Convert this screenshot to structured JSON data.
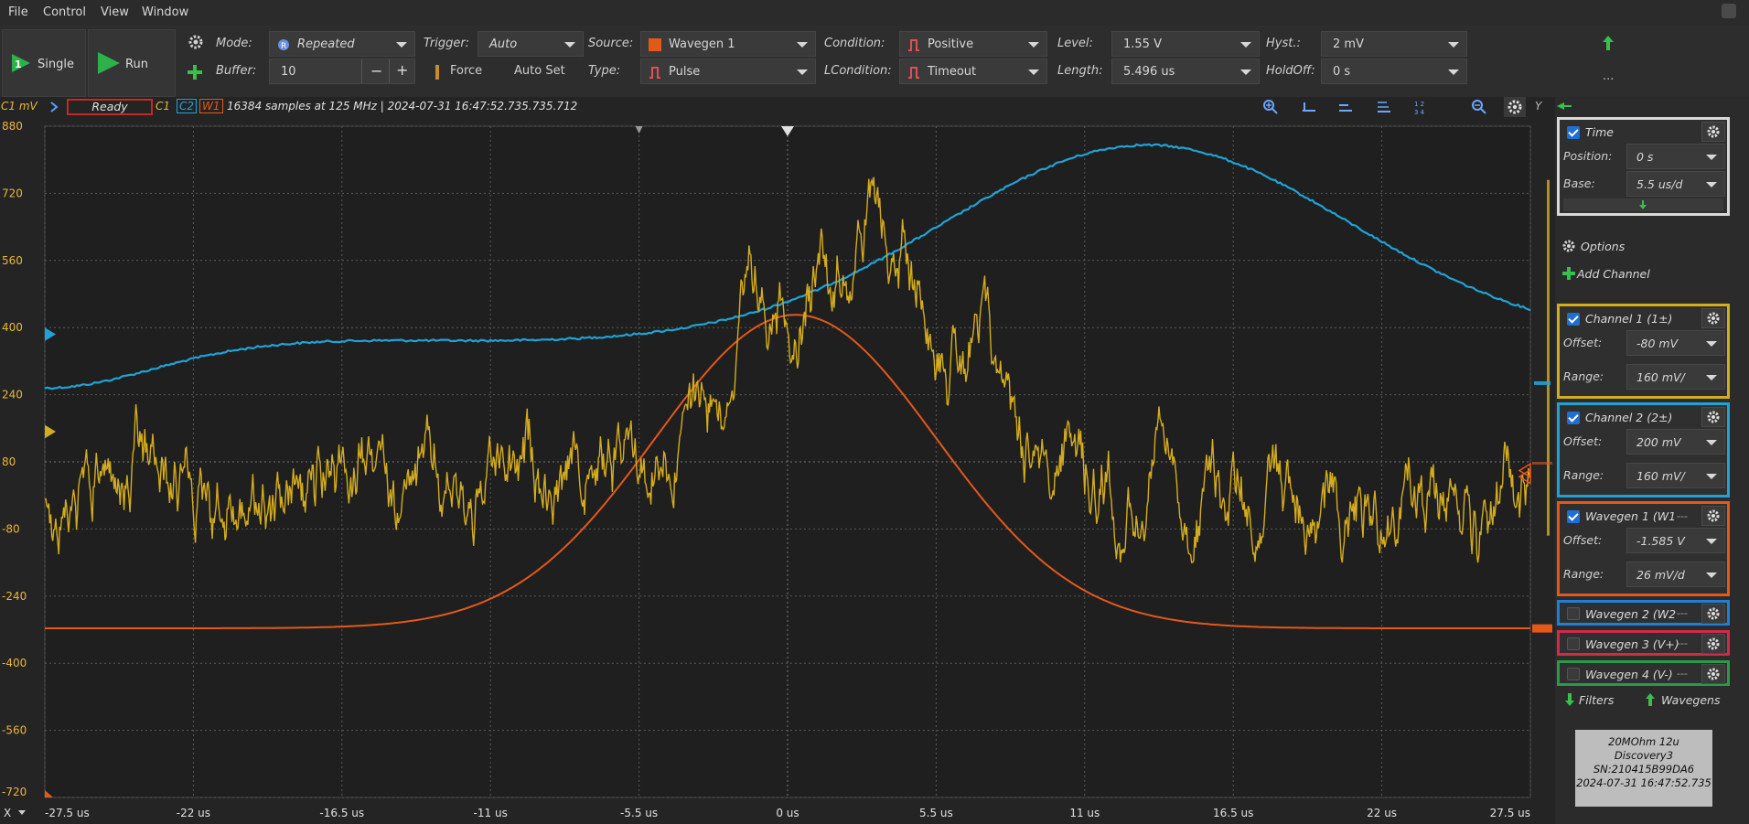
{
  "menu": [
    "File",
    "Control",
    "View",
    "Window"
  ],
  "toolbar": {
    "single_label": "Single",
    "run_label": "Run",
    "mode_label": "Mode:",
    "mode_value": "Repeated",
    "buffer_label": "Buffer:",
    "buffer_value": "10",
    "trigger_label": "Trigger:",
    "trigger_value": "Auto",
    "force_label": "Force",
    "autoset_label": "Auto Set",
    "source_label": "Source:",
    "source_value": "Wavegen 1",
    "type_label": "Type:",
    "type_value": "Pulse",
    "condition_label": "Condition:",
    "condition_value": "Positive",
    "lcondition_label": "LCondition:",
    "lcondition_value": "Timeout",
    "level_label": "Level:",
    "level_value": "1.55 V",
    "length_label": "Length:",
    "length_value": "5.496 us",
    "hyst_label": "Hyst.:",
    "hyst_value": "2 mV",
    "holdoff_label": "HoldOff:",
    "holdoff_value": "0 s",
    "more_label": "..."
  },
  "status": {
    "unit": "C1 mV",
    "state": "Ready",
    "ch1": "C1",
    "ch2": "C2",
    "w1": "W1",
    "info": "16384 samples at 125 MHz  | 2024-07-31 16:47:52.735.735.712",
    "y_label": "Y"
  },
  "plot": {
    "y_ticks": [
      "880",
      "720",
      "560",
      "400",
      "240",
      "80",
      "-80",
      "-240",
      "-400",
      "-560",
      "-720"
    ],
    "x_ticks": [
      "-27.5 us",
      "-22 us",
      "-16.5 us",
      "-11 us",
      "-5.5 us",
      "0 us",
      "5.5 us",
      "11 us",
      "16.5 us",
      "22 us",
      "27.5 us"
    ],
    "x_axis_label": "X",
    "colors": {
      "ch1": "#d4ac1f",
      "ch2": "#1fa3d6",
      "w1": "#e4581a",
      "grid": "#5a5a5a",
      "bg": "#1f1f1f"
    }
  },
  "panel": {
    "time": {
      "title": "Time",
      "position_label": "Position:",
      "position_value": "0 s",
      "base_label": "Base:",
      "base_value": "5.5 us/d"
    },
    "options_label": "Options",
    "add_channel_label": "Add Channel",
    "ch1": {
      "title": "Channel 1 (1±)",
      "offset_label": "Offset:",
      "offset_value": "-80 mV",
      "range_label": "Range:",
      "range_value": "160 mV/"
    },
    "ch2": {
      "title": "Channel 2 (2±)",
      "offset_label": "Offset:",
      "offset_value": "200 mV",
      "range_label": "Range:",
      "range_value": "160 mV/"
    },
    "w1": {
      "title": "Wavegen 1 (W1",
      "offset_label": "Offset:",
      "offset_value": "-1.585 V",
      "range_label": "Range:",
      "range_value": "26 mV/d"
    },
    "w2": {
      "title": "Wavegen 2 (W2"
    },
    "w3": {
      "title": "Wavegen 3 (V+)"
    },
    "w4": {
      "title": "Wavegen 4 (V-)"
    },
    "dots": "---",
    "filters_label": "Filters",
    "wavegens_label": "Wavegens",
    "device": {
      "line1": "20MOhm 12u",
      "line2": "Discovery3",
      "line3": "SN:210415B99DA6",
      "line4": "2024-07-31 16:47:52.735"
    }
  }
}
